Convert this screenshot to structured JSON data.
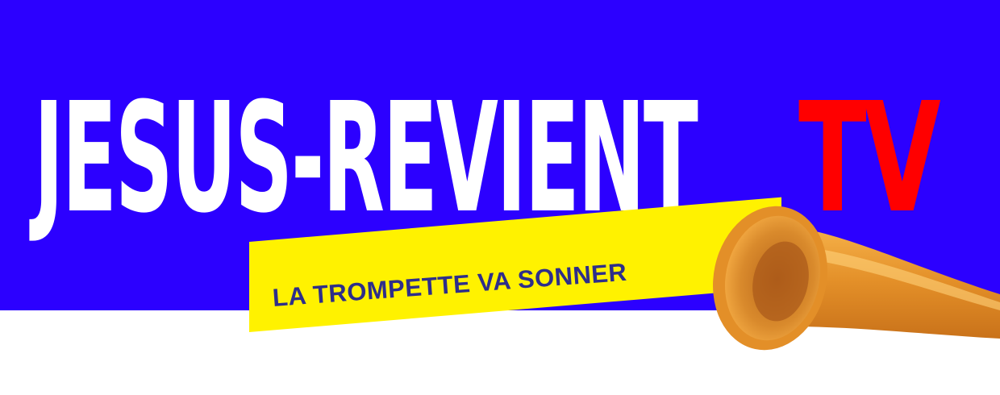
{
  "banner": {
    "title_main": "JESUS-REVIENT",
    "title_accent": "TV",
    "tagline": "LA TROMPETTE VA SONNER"
  },
  "colors": {
    "band": "#2c00ff",
    "title_main": "#ffffff",
    "title_accent": "#ff0000",
    "tagline_strip": "#fff200",
    "tagline_text": "#2e2e8a",
    "trumpet": "#e89a32"
  },
  "icons": {
    "trumpet": "trumpet-icon"
  }
}
